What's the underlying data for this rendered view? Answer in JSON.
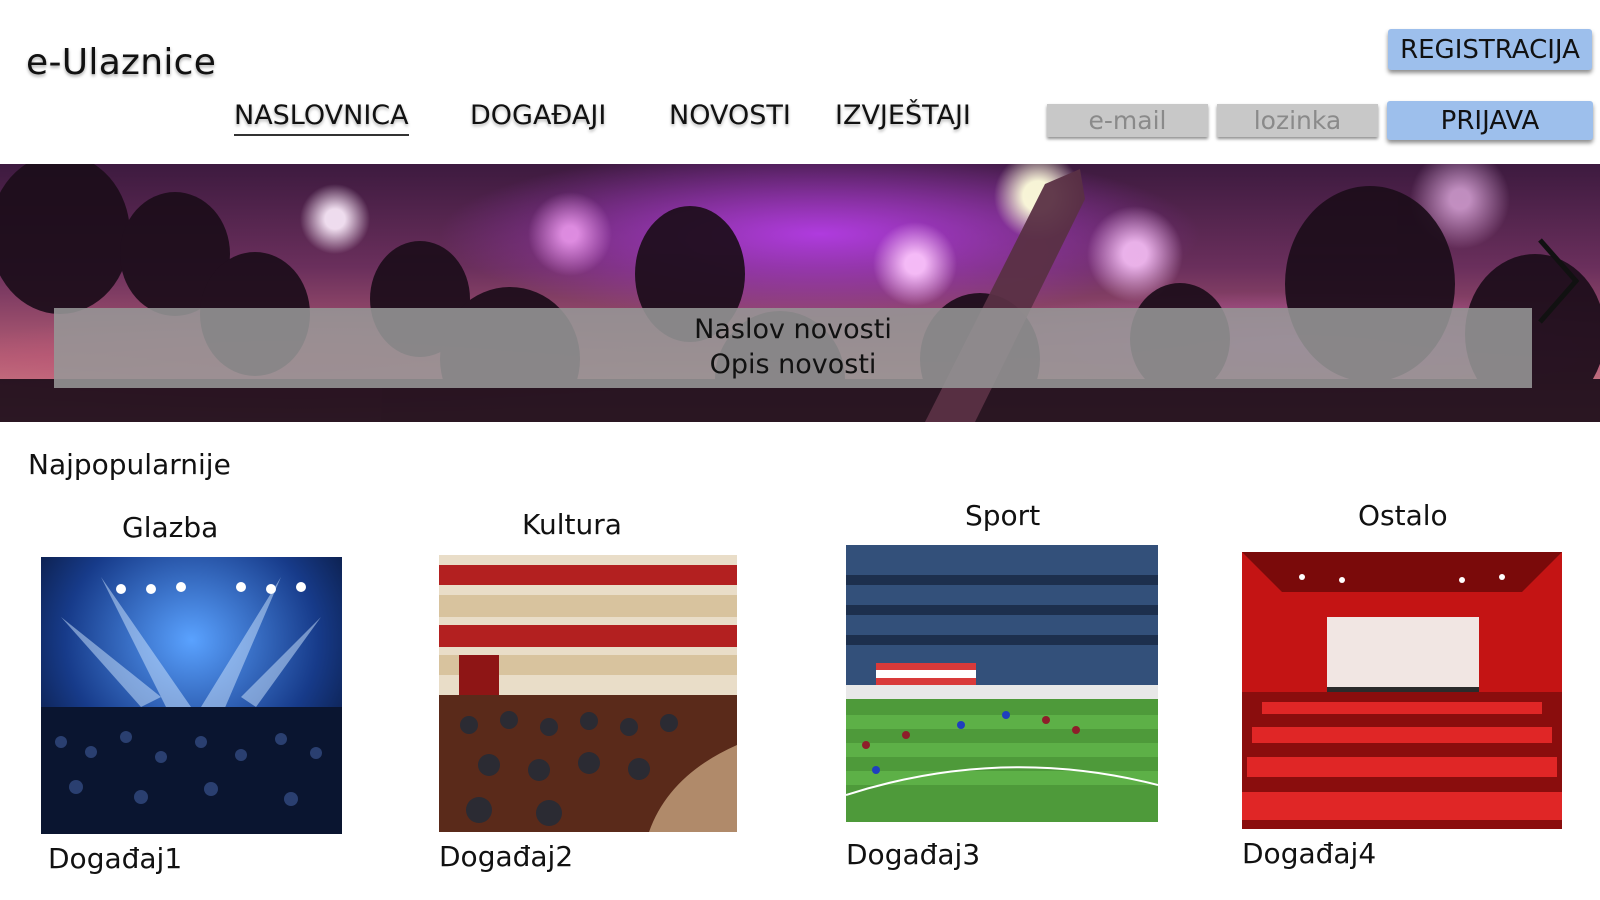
{
  "header": {
    "logo": "e-Ulaznice",
    "register_label": "REGISTRACIJA",
    "login_label": "PRIJAVA",
    "email_placeholder": "e-mail",
    "password_placeholder": "lozinka"
  },
  "nav": {
    "items": [
      {
        "label": "NASLOVNICA",
        "active": true
      },
      {
        "label": "DOGAĐAJI",
        "active": false
      },
      {
        "label": "NOVOSTI",
        "active": false
      },
      {
        "label": "IZVJEŠTAJI",
        "active": false
      }
    ]
  },
  "hero": {
    "title": "Naslov novosti",
    "description": "Opis novosti",
    "next_icon": "chevron-right-icon"
  },
  "popular": {
    "title": "Najpopularnije",
    "categories": [
      {
        "name": "Glazba",
        "event": "Događaj1"
      },
      {
        "name": "Kultura",
        "event": "Događaj2"
      },
      {
        "name": "Sport",
        "event": "Događaj3"
      },
      {
        "name": "Ostalo",
        "event": "Događaj4"
      }
    ]
  },
  "colors": {
    "button": "#9dbfec",
    "input": "#c8c8c8",
    "caption_bar": "#969696"
  }
}
